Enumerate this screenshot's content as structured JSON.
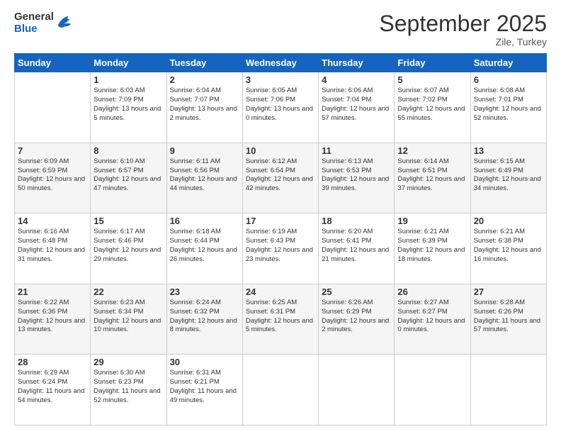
{
  "header": {
    "logo": {
      "general": "General",
      "blue": "Blue"
    },
    "title": "September 2025",
    "location": "Zile, Turkey"
  },
  "days_of_week": [
    "Sunday",
    "Monday",
    "Tuesday",
    "Wednesday",
    "Thursday",
    "Friday",
    "Saturday"
  ],
  "weeks": [
    [
      {
        "day": null,
        "sunrise": null,
        "sunset": null,
        "daylight": null
      },
      {
        "day": "1",
        "sunrise": "Sunrise: 6:03 AM",
        "sunset": "Sunset: 7:09 PM",
        "daylight": "Daylight: 13 hours and 5 minutes."
      },
      {
        "day": "2",
        "sunrise": "Sunrise: 6:04 AM",
        "sunset": "Sunset: 7:07 PM",
        "daylight": "Daylight: 13 hours and 2 minutes."
      },
      {
        "day": "3",
        "sunrise": "Sunrise: 6:05 AM",
        "sunset": "Sunset: 7:06 PM",
        "daylight": "Daylight: 13 hours and 0 minutes."
      },
      {
        "day": "4",
        "sunrise": "Sunrise: 6:06 AM",
        "sunset": "Sunset: 7:04 PM",
        "daylight": "Daylight: 12 hours and 57 minutes."
      },
      {
        "day": "5",
        "sunrise": "Sunrise: 6:07 AM",
        "sunset": "Sunset: 7:02 PM",
        "daylight": "Daylight: 12 hours and 55 minutes."
      },
      {
        "day": "6",
        "sunrise": "Sunrise: 6:08 AM",
        "sunset": "Sunset: 7:01 PM",
        "daylight": "Daylight: 12 hours and 52 minutes."
      }
    ],
    [
      {
        "day": "7",
        "sunrise": "Sunrise: 6:09 AM",
        "sunset": "Sunset: 6:59 PM",
        "daylight": "Daylight: 12 hours and 50 minutes."
      },
      {
        "day": "8",
        "sunrise": "Sunrise: 6:10 AM",
        "sunset": "Sunset: 6:57 PM",
        "daylight": "Daylight: 12 hours and 47 minutes."
      },
      {
        "day": "9",
        "sunrise": "Sunrise: 6:11 AM",
        "sunset": "Sunset: 6:56 PM",
        "daylight": "Daylight: 12 hours and 44 minutes."
      },
      {
        "day": "10",
        "sunrise": "Sunrise: 6:12 AM",
        "sunset": "Sunset: 6:54 PM",
        "daylight": "Daylight: 12 hours and 42 minutes."
      },
      {
        "day": "11",
        "sunrise": "Sunrise: 6:13 AM",
        "sunset": "Sunset: 6:53 PM",
        "daylight": "Daylight: 12 hours and 39 minutes."
      },
      {
        "day": "12",
        "sunrise": "Sunrise: 6:14 AM",
        "sunset": "Sunset: 6:51 PM",
        "daylight": "Daylight: 12 hours and 37 minutes."
      },
      {
        "day": "13",
        "sunrise": "Sunrise: 6:15 AM",
        "sunset": "Sunset: 6:49 PM",
        "daylight": "Daylight: 12 hours and 34 minutes."
      }
    ],
    [
      {
        "day": "14",
        "sunrise": "Sunrise: 6:16 AM",
        "sunset": "Sunset: 6:48 PM",
        "daylight": "Daylight: 12 hours and 31 minutes."
      },
      {
        "day": "15",
        "sunrise": "Sunrise: 6:17 AM",
        "sunset": "Sunset: 6:46 PM",
        "daylight": "Daylight: 12 hours and 29 minutes."
      },
      {
        "day": "16",
        "sunrise": "Sunrise: 6:18 AM",
        "sunset": "Sunset: 6:44 PM",
        "daylight": "Daylight: 12 hours and 26 minutes."
      },
      {
        "day": "17",
        "sunrise": "Sunrise: 6:19 AM",
        "sunset": "Sunset: 6:43 PM",
        "daylight": "Daylight: 12 hours and 23 minutes."
      },
      {
        "day": "18",
        "sunrise": "Sunrise: 6:20 AM",
        "sunset": "Sunset: 6:41 PM",
        "daylight": "Daylight: 12 hours and 21 minutes."
      },
      {
        "day": "19",
        "sunrise": "Sunrise: 6:21 AM",
        "sunset": "Sunset: 6:39 PM",
        "daylight": "Daylight: 12 hours and 18 minutes."
      },
      {
        "day": "20",
        "sunrise": "Sunrise: 6:21 AM",
        "sunset": "Sunset: 6:38 PM",
        "daylight": "Daylight: 12 hours and 16 minutes."
      }
    ],
    [
      {
        "day": "21",
        "sunrise": "Sunrise: 6:22 AM",
        "sunset": "Sunset: 6:36 PM",
        "daylight": "Daylight: 12 hours and 13 minutes."
      },
      {
        "day": "22",
        "sunrise": "Sunrise: 6:23 AM",
        "sunset": "Sunset: 6:34 PM",
        "daylight": "Daylight: 12 hours and 10 minutes."
      },
      {
        "day": "23",
        "sunrise": "Sunrise: 6:24 AM",
        "sunset": "Sunset: 6:32 PM",
        "daylight": "Daylight: 12 hours and 8 minutes."
      },
      {
        "day": "24",
        "sunrise": "Sunrise: 6:25 AM",
        "sunset": "Sunset: 6:31 PM",
        "daylight": "Daylight: 12 hours and 5 minutes."
      },
      {
        "day": "25",
        "sunrise": "Sunrise: 6:26 AM",
        "sunset": "Sunset: 6:29 PM",
        "daylight": "Daylight: 12 hours and 2 minutes."
      },
      {
        "day": "26",
        "sunrise": "Sunrise: 6:27 AM",
        "sunset": "Sunset: 6:27 PM",
        "daylight": "Daylight: 12 hours and 0 minutes."
      },
      {
        "day": "27",
        "sunrise": "Sunrise: 6:28 AM",
        "sunset": "Sunset: 6:26 PM",
        "daylight": "Daylight: 11 hours and 57 minutes."
      }
    ],
    [
      {
        "day": "28",
        "sunrise": "Sunrise: 6:29 AM",
        "sunset": "Sunset: 6:24 PM",
        "daylight": "Daylight: 11 hours and 54 minutes."
      },
      {
        "day": "29",
        "sunrise": "Sunrise: 6:30 AM",
        "sunset": "Sunset: 6:23 PM",
        "daylight": "Daylight: 11 hours and 52 minutes."
      },
      {
        "day": "30",
        "sunrise": "Sunrise: 6:31 AM",
        "sunset": "Sunset: 6:21 PM",
        "daylight": "Daylight: 11 hours and 49 minutes."
      },
      {
        "day": null,
        "sunrise": null,
        "sunset": null,
        "daylight": null
      },
      {
        "day": null,
        "sunrise": null,
        "sunset": null,
        "daylight": null
      },
      {
        "day": null,
        "sunrise": null,
        "sunset": null,
        "daylight": null
      },
      {
        "day": null,
        "sunrise": null,
        "sunset": null,
        "daylight": null
      }
    ]
  ]
}
